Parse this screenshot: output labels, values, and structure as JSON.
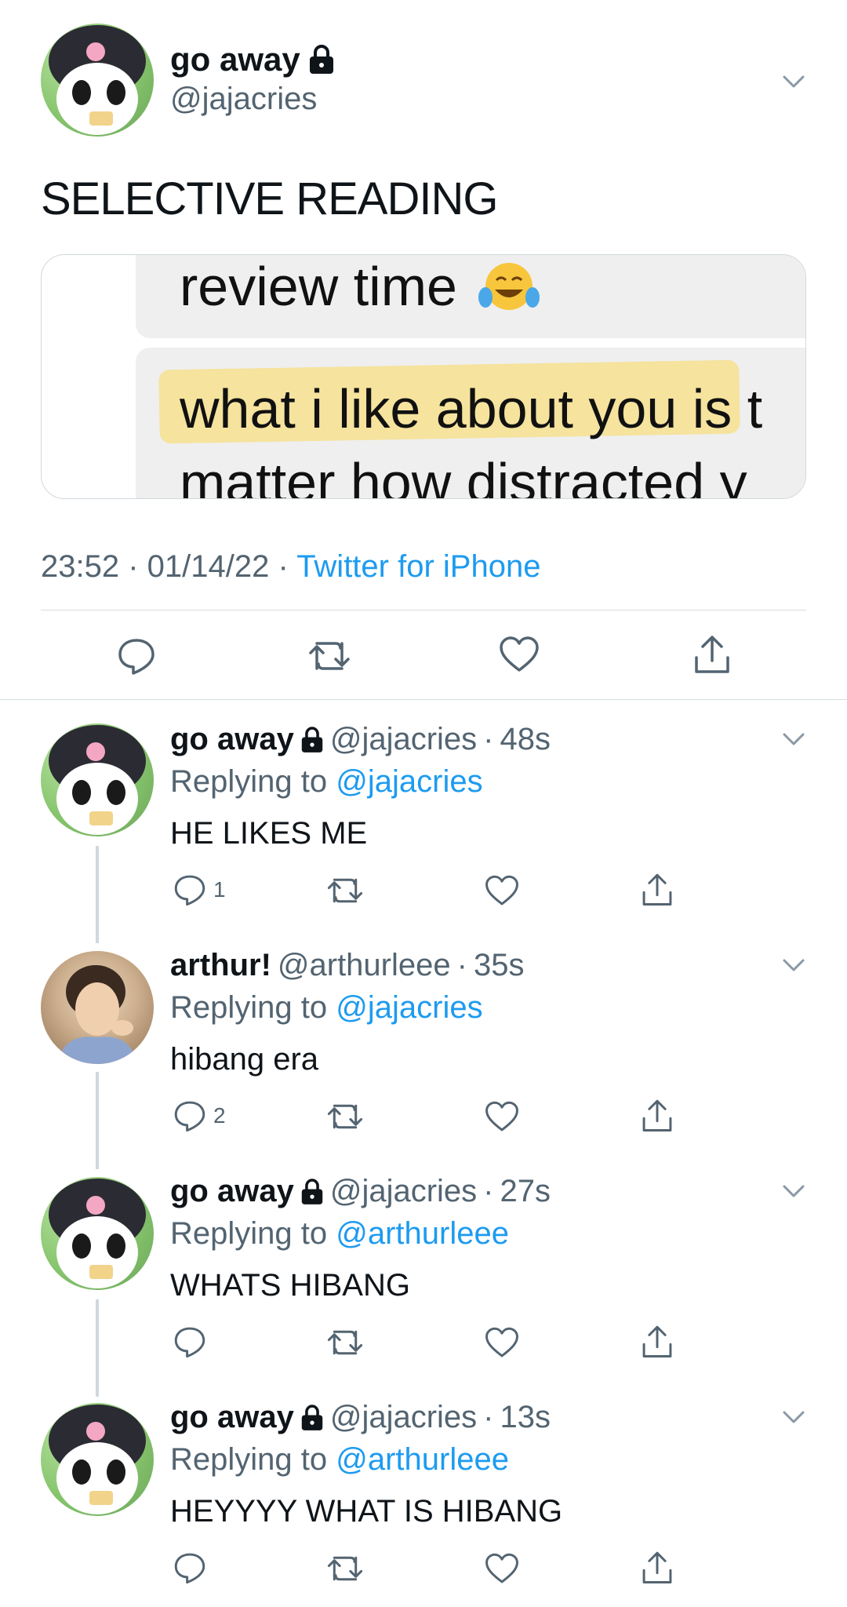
{
  "main_tweet": {
    "display_name": "go away",
    "handle": "@jajacries",
    "text": "SELECTIVE READING",
    "media": {
      "top_bubble_text": "review time",
      "line1_highlighted": "what i like about you",
      "line1_rest": " is t",
      "line2": "matter how distracted y"
    },
    "time": "23:52",
    "date": "01/14/22",
    "source": "Twitter for iPhone",
    "separator": " · "
  },
  "replies": [
    {
      "display_name": "go away",
      "handle": "@jajacries",
      "time": "48s",
      "replying_prefix": "Replying to",
      "replying_to": "@jajacries",
      "text": "HE LIKES ME",
      "reply_count": "1",
      "avatar": "kuromi"
    },
    {
      "display_name": "arthur!",
      "handle": "@arthurleee",
      "time": "35s",
      "replying_prefix": "Replying to",
      "replying_to": "@jajacries",
      "text": "hibang era",
      "reply_count": "2",
      "avatar": "arthur"
    },
    {
      "display_name": "go away",
      "handle": "@jajacries",
      "time": "27s",
      "replying_prefix": "Replying to",
      "replying_to": "@arthurleee",
      "text": "WHATS HIBANG",
      "reply_count": "",
      "avatar": "kuromi"
    },
    {
      "display_name": "go away",
      "handle": "@jajacries",
      "time": "13s",
      "replying_prefix": "Replying to",
      "replying_to": "@arthurleee",
      "text": "HEYYYY WHAT IS HIBANG",
      "reply_count": "",
      "avatar": "kuromi"
    }
  ],
  "icons": {
    "lock": "lock-icon",
    "chevron": "chevron-down-icon",
    "reply": "reply-icon",
    "retweet": "retweet-icon",
    "like": "heart-icon",
    "share": "share-icon",
    "emoji": "laughing-tears-emoji"
  },
  "colors": {
    "text": "#0f1419",
    "secondary": "#536471",
    "link": "#1d9bf0",
    "divider": "#d7dde0",
    "highlight": "#f6e08f"
  }
}
